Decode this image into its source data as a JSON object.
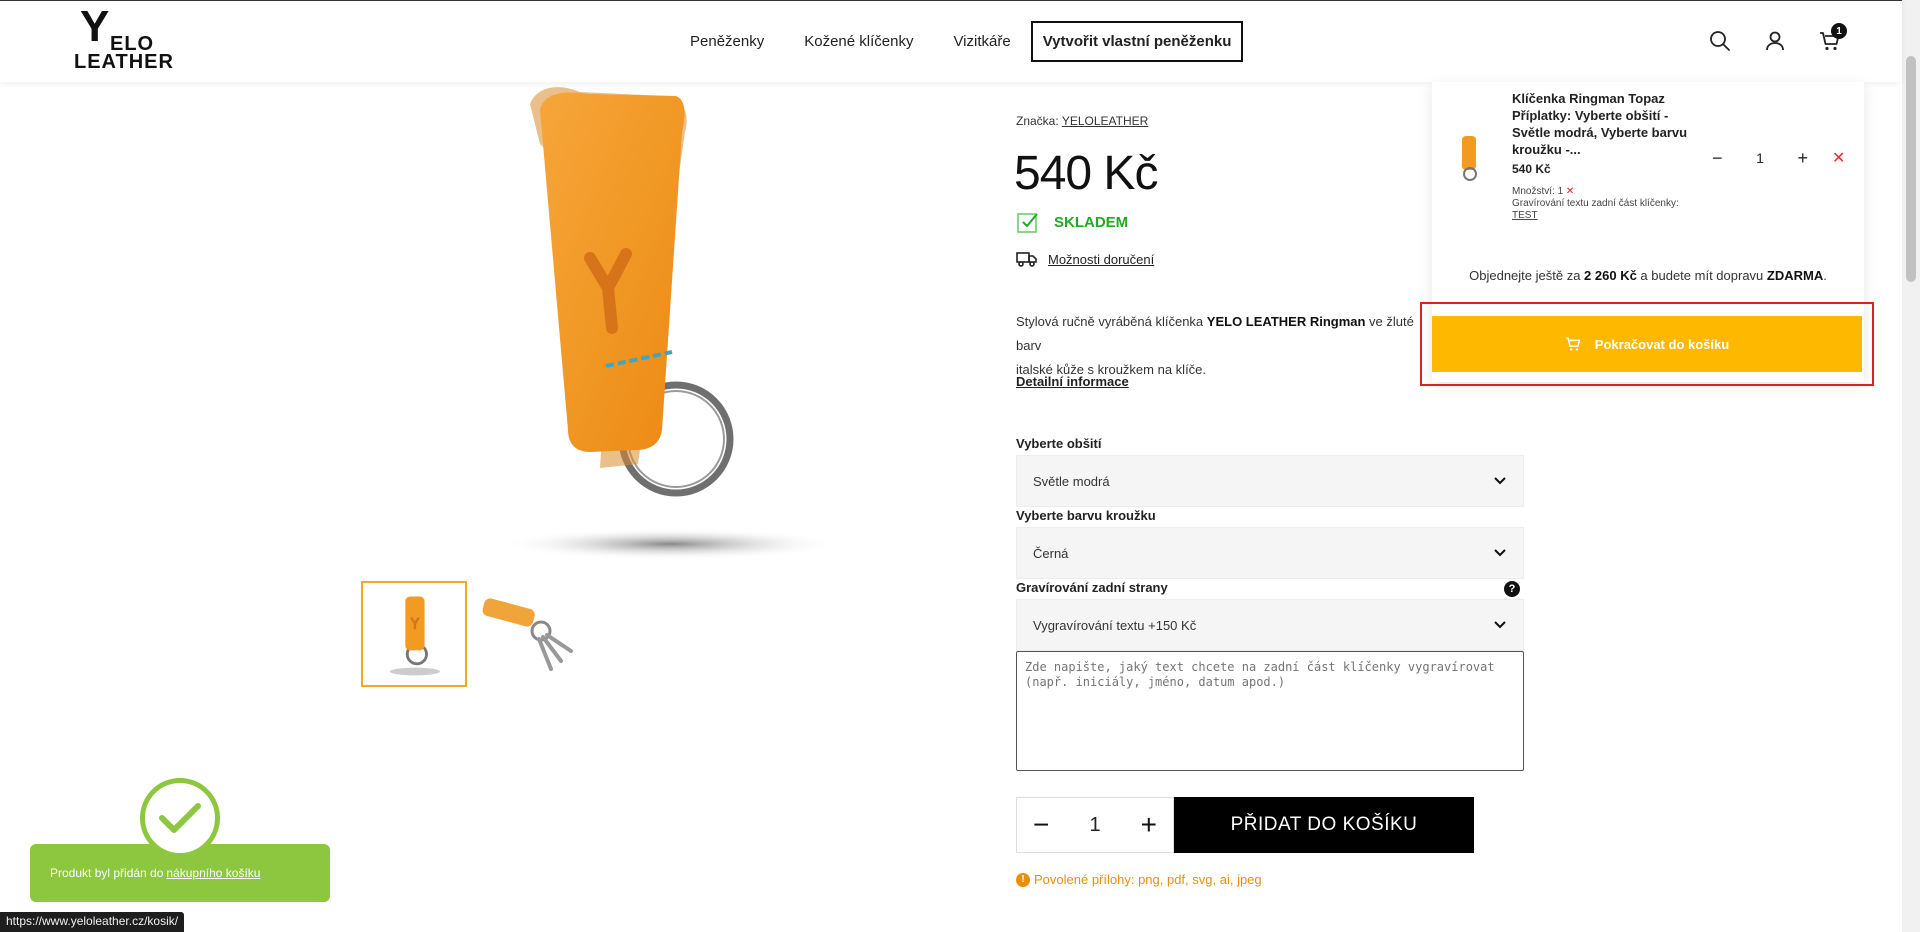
{
  "header": {
    "logo_lines": [
      "Y",
      "ELO",
      "LEATHER"
    ],
    "nav": [
      "Peněženky",
      "Kožené klíčenky",
      "Vizitkáře"
    ],
    "nav_cta": "Vytvořit vlastní peněženku",
    "cart_count": "1"
  },
  "product": {
    "brand_label": "Značka: ",
    "brand_value": "YELOLEATHER",
    "price": "540 Kč",
    "stock": "SKLADEM",
    "delivery": "Možnosti doručení",
    "description_a": "Stylová ručně vyráběná klíčenka ",
    "description_bold": "YELO LEATHER Ringman",
    "description_b": " ve žluté barv",
    "description_c": "italské kůže s kroužkem na klíče.",
    "detail_link": "Detailní informace"
  },
  "options": {
    "stitch_label": "Vyberte obšití",
    "stitch_value": "Světle modrá",
    "ring_label": "Vyberte barvu kroužku",
    "ring_value": "Černá",
    "engrave_label": "Gravírování zadní strany",
    "engrave_help": "?",
    "engrave_value": "Vygravírování textu +150 Kč",
    "engrave_placeholder": "Zde napište, jaký text chcete na zadní část klíčenky vygravírovat (např. iniciály, jméno, datum apod.)"
  },
  "buy": {
    "qty_minus": "−",
    "qty_value": "1",
    "qty_plus": "+",
    "add_to_cart": "PŘIDAT DO KOŠÍKU",
    "attachments_icon": "!",
    "attachments": "Povolené přílohy: png, pdf, svg, ai, jpeg"
  },
  "mini_cart": {
    "item_title": "Klíčenka Ringman Topaz Příplatky: Vyberte obšití - Světle modrá, Vyberte barvu kroužku -...",
    "item_price": "540 Kč",
    "meta_qty": "Množství: 1",
    "meta_qty_x": "✕",
    "meta_engrave": "Gravírování textu zadní část klíčenky:",
    "meta_engrave_value": "TEST",
    "qty_minus": "−",
    "qty_value": "1",
    "qty_plus": "+",
    "remove": "✕",
    "free_a": "Objednejte ještě za ",
    "free_amount": "2 260 Kč",
    "free_b": " a budete mít dopravu ",
    "free_word": "ZDARMA",
    "free_end": ".",
    "continue": "Pokračovat do košíku"
  },
  "toast": {
    "text": "Produkt byl přidán do",
    "link": "nákupního košíku"
  },
  "status_url": "https://www.yeloleather.cz/kosik/",
  "colors": {
    "accent_yellow": "#ffb800",
    "success_green": "#8dc63f",
    "stock_green": "#22aa22",
    "highlight_red": "#e02020",
    "leather_orange": "#f29b22"
  }
}
